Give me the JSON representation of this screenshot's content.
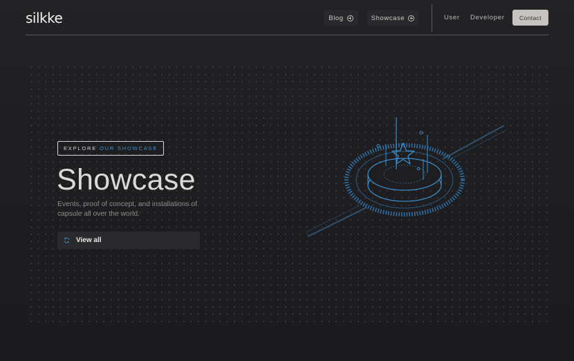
{
  "header": {
    "logo": "silkke",
    "nav": {
      "blog_label": "Blog",
      "showcase_label": "Showcase",
      "user_label": "User",
      "developer_label": "Developer",
      "contact_label": "Contact"
    }
  },
  "hero": {
    "eyebrow_prefix": "EXPLORE",
    "eyebrow_accent": "OUR SHOWCASE",
    "title": "Showcase",
    "description": "Events, proof of concept, and installations of capsule all over the world.",
    "cta_label": "View all"
  },
  "colors": {
    "accent": "#3b8fcf",
    "background": "#1e1e20",
    "contact_button": "#c6c3c1"
  },
  "icons": {
    "nav_plus": "plus-circle-icon",
    "cta": "refresh-icon",
    "illustration": "isometric-star-stage-icon"
  }
}
